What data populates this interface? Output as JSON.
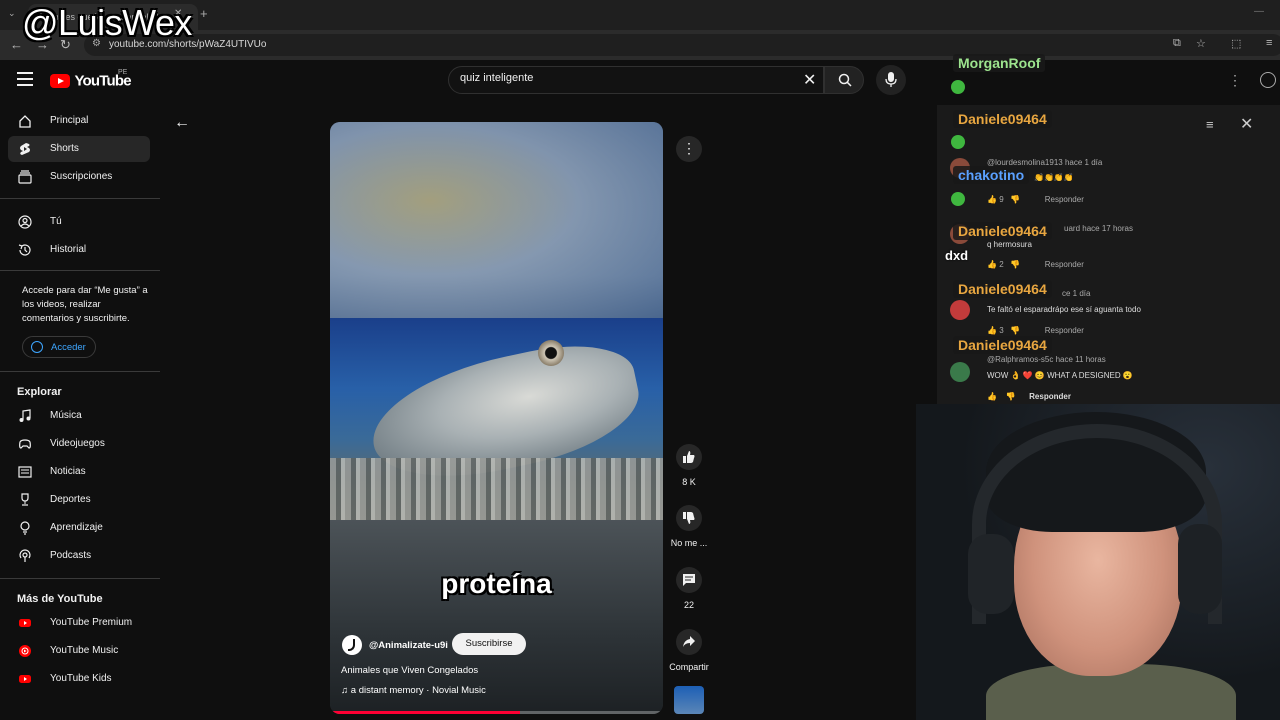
{
  "browser": {
    "tab_title": "Animales que Viven Congelados",
    "url": "youtube.com/shorts/pWaZ4UTIVUo"
  },
  "overlay": {
    "watermark": "@LuisWex"
  },
  "header": {
    "logo_text": "YouTube",
    "region": "PE",
    "search_value": "quiz inteligente"
  },
  "sidebar": {
    "main": [
      {
        "label": "Principal",
        "icon": "home-icon"
      },
      {
        "label": "Shorts",
        "icon": "shorts-icon",
        "active": true
      },
      {
        "label": "Suscripciones",
        "icon": "subscriptions-icon"
      }
    ],
    "you": [
      {
        "label": "Tú",
        "icon": "user-icon"
      },
      {
        "label": "Historial",
        "icon": "history-icon"
      }
    ],
    "signin_text": "Accede para dar “Me gusta” a los videos, realizar comentarios y suscribirte.",
    "signin_button": "Acceder",
    "explore_title": "Explorar",
    "explore": [
      {
        "label": "Música",
        "icon": "music-icon"
      },
      {
        "label": "Videojuegos",
        "icon": "gaming-icon"
      },
      {
        "label": "Noticias",
        "icon": "news-icon"
      },
      {
        "label": "Deportes",
        "icon": "trophy-icon"
      },
      {
        "label": "Aprendizaje",
        "icon": "lightbulb-icon"
      },
      {
        "label": "Podcasts",
        "icon": "podcast-icon"
      }
    ],
    "more_title": "Más de YouTube",
    "more": [
      {
        "label": "YouTube Premium"
      },
      {
        "label": "YouTube Music"
      },
      {
        "label": "YouTube Kids"
      }
    ]
  },
  "short": {
    "caption": "proteína",
    "channel": "@Animalizate-u9i",
    "subscribe": "Suscribirse",
    "title": "Animales que Viven Congelados",
    "music": "a distant memory · Novial Music",
    "progress": 0.57,
    "likes": "8 K",
    "dislike_label": "No me ...",
    "comments": "22",
    "share_label": "Compartir"
  },
  "comments": [
    {
      "author": "@lourdesmolina1913",
      "time": "hace 1 día",
      "text": "👏👏👏👏",
      "likes": "9",
      "reply": "Responder"
    },
    {
      "author": "uard",
      "time": "hace 17 horas",
      "text": "q hermosura",
      "likes": "2",
      "reply": "Responder"
    },
    {
      "author": "",
      "time": "ce 1 día",
      "text": "Te faltó el esparadrápo ese sí aguanta todo",
      "likes": "3",
      "reply": "Responder"
    },
    {
      "author": "@Ralphramos-s5c",
      "time": "hace 11 horas",
      "text": "WOW 👌 ❤️ 😊 WHAT A DESIGNED 😮",
      "likes": "",
      "reply": "Responder"
    }
  ],
  "chat_overlay": [
    {
      "name": "MorganRoof",
      "color": "#9de48e"
    },
    {
      "name": "Daniele09464",
      "color": "#e8a640"
    },
    {
      "name": "chakotino",
      "color": "#5aa0ff"
    },
    {
      "name": "Daniele09464",
      "color": "#e8a640"
    },
    {
      "name": "Daniele09464",
      "color": "#e8a640"
    },
    {
      "name": "Daniele09464",
      "color": "#e8a640"
    }
  ],
  "chat_plain": "dxd"
}
